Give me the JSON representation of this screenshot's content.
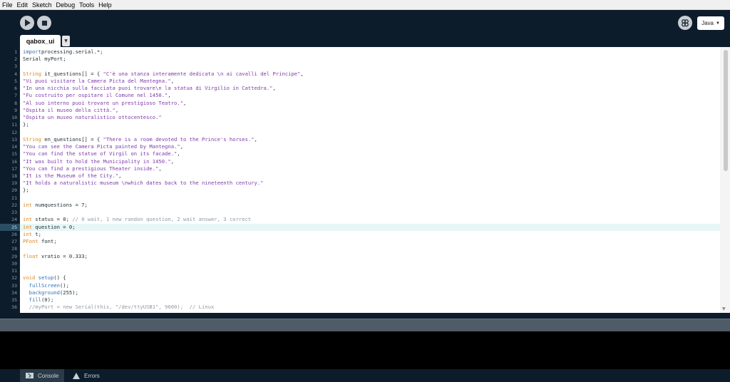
{
  "menu": [
    "File",
    "Edit",
    "Sketch",
    "Debug",
    "Tools",
    "Help"
  ],
  "toolbar": {
    "run_icon": "play-icon",
    "stop_icon": "stop-icon",
    "debug_icon": "debugger-icon",
    "mode_label": "Java",
    "mode_caret": "▼"
  },
  "tabs": {
    "active": "qabox_ui",
    "menu_glyph": "▼"
  },
  "editor": {
    "current_line": 25,
    "lines": [
      [
        [
          "kb",
          "import"
        ],
        [
          "",
          "processing.serial.*;"
        ]
      ],
      [
        [
          "",
          "Serial myPort;"
        ]
      ],
      [
        [
          "",
          ""
        ]
      ],
      [
        [
          "kw",
          "String"
        ],
        [
          "",
          " it_questions[] = { "
        ],
        [
          "str",
          "\"C'è una stanza interamente dedicata \\n ai cavalli del Principe\""
        ],
        [
          "",
          ","
        ]
      ],
      [
        [
          "str",
          "\"Vi puoi visitare la Camera Picta del Mantegna.\""
        ],
        [
          "",
          ","
        ]
      ],
      [
        [
          "str",
          "\"In una nicchia sulla facciata puoi trovare\\n la statua di Virgilio in Cattedra.\""
        ],
        [
          "",
          ","
        ]
      ],
      [
        [
          "str",
          "\"Fu costruito per ospitare il Comune nel 1450.\""
        ],
        [
          "",
          ","
        ]
      ],
      [
        [
          "str",
          "\"Al suo interno puoi trovare un prestigioso Teatro.\""
        ],
        [
          "",
          ","
        ]
      ],
      [
        [
          "str",
          "\"Ospita il museo della città.\""
        ],
        [
          "",
          ","
        ]
      ],
      [
        [
          "str",
          "\"Ospita un museo naturalistico ottocentesco.\""
        ]
      ],
      [
        [
          "",
          "};"
        ]
      ],
      [
        [
          "",
          ""
        ]
      ],
      [
        [
          "kw",
          "String"
        ],
        [
          "",
          " en_questions[] = { "
        ],
        [
          "str",
          "\"There is a room devoted to the Prince's horses.\""
        ],
        [
          "",
          ","
        ]
      ],
      [
        [
          "str",
          "\"You can see the Camera Picta painted by Mantegna.\""
        ],
        [
          "",
          ","
        ]
      ],
      [
        [
          "str",
          "\"You can find the statue of Virgil on its facade.\""
        ],
        [
          "",
          ","
        ]
      ],
      [
        [
          "str",
          "\"It was built to hold the Municipality in 1450.\""
        ],
        [
          "",
          ","
        ]
      ],
      [
        [
          "str",
          "\"You can find a prestigious Theater inside.\""
        ],
        [
          "",
          ","
        ]
      ],
      [
        [
          "str",
          "\"It is the Museum of the City.\""
        ],
        [
          "",
          ","
        ]
      ],
      [
        [
          "str",
          "\"It holds a naturalistic museum \\nwhich dates back to the nineteenth century.\""
        ]
      ],
      [
        [
          "",
          "};"
        ]
      ],
      [
        [
          "",
          ""
        ]
      ],
      [
        [
          "kw",
          "int"
        ],
        [
          "",
          " numquestions = 7;"
        ]
      ],
      [
        [
          "",
          ""
        ]
      ],
      [
        [
          "kw",
          "int"
        ],
        [
          "",
          " status = 0; "
        ],
        [
          "cm",
          "// 0 wait, 1 new randon question, 2 wait answer, 3 correct"
        ]
      ],
      [
        [
          "kw",
          "int"
        ],
        [
          "",
          " question = 0;"
        ]
      ],
      [
        [
          "kw",
          "int"
        ],
        [
          "",
          " t;"
        ]
      ],
      [
        [
          "kw",
          "PFont"
        ],
        [
          "",
          " font;"
        ]
      ],
      [
        [
          "",
          ""
        ]
      ],
      [
        [
          "kw",
          "float"
        ],
        [
          "",
          " vratio = 0.333;"
        ]
      ],
      [
        [
          "",
          ""
        ]
      ],
      [
        [
          "",
          ""
        ]
      ],
      [
        [
          "kw",
          "void"
        ],
        [
          "",
          " "
        ],
        [
          "kb",
          "setup"
        ],
        [
          "",
          "() {"
        ]
      ],
      [
        [
          "",
          "  "
        ],
        [
          "kb",
          "fullScreen"
        ],
        [
          "",
          "();"
        ]
      ],
      [
        [
          "",
          "  "
        ],
        [
          "kb",
          "background"
        ],
        [
          "",
          "(255);"
        ]
      ],
      [
        [
          "",
          "  "
        ],
        [
          "kb",
          "fill"
        ],
        [
          "",
          "(0);"
        ]
      ],
      [
        [
          "",
          "  "
        ],
        [
          "cm",
          "//myPort = new Serial(this, \"/dev/ttyUSB1\", 9600);  // Linux"
        ]
      ]
    ]
  },
  "footer": {
    "console_label": "Console",
    "errors_label": "Errors"
  }
}
